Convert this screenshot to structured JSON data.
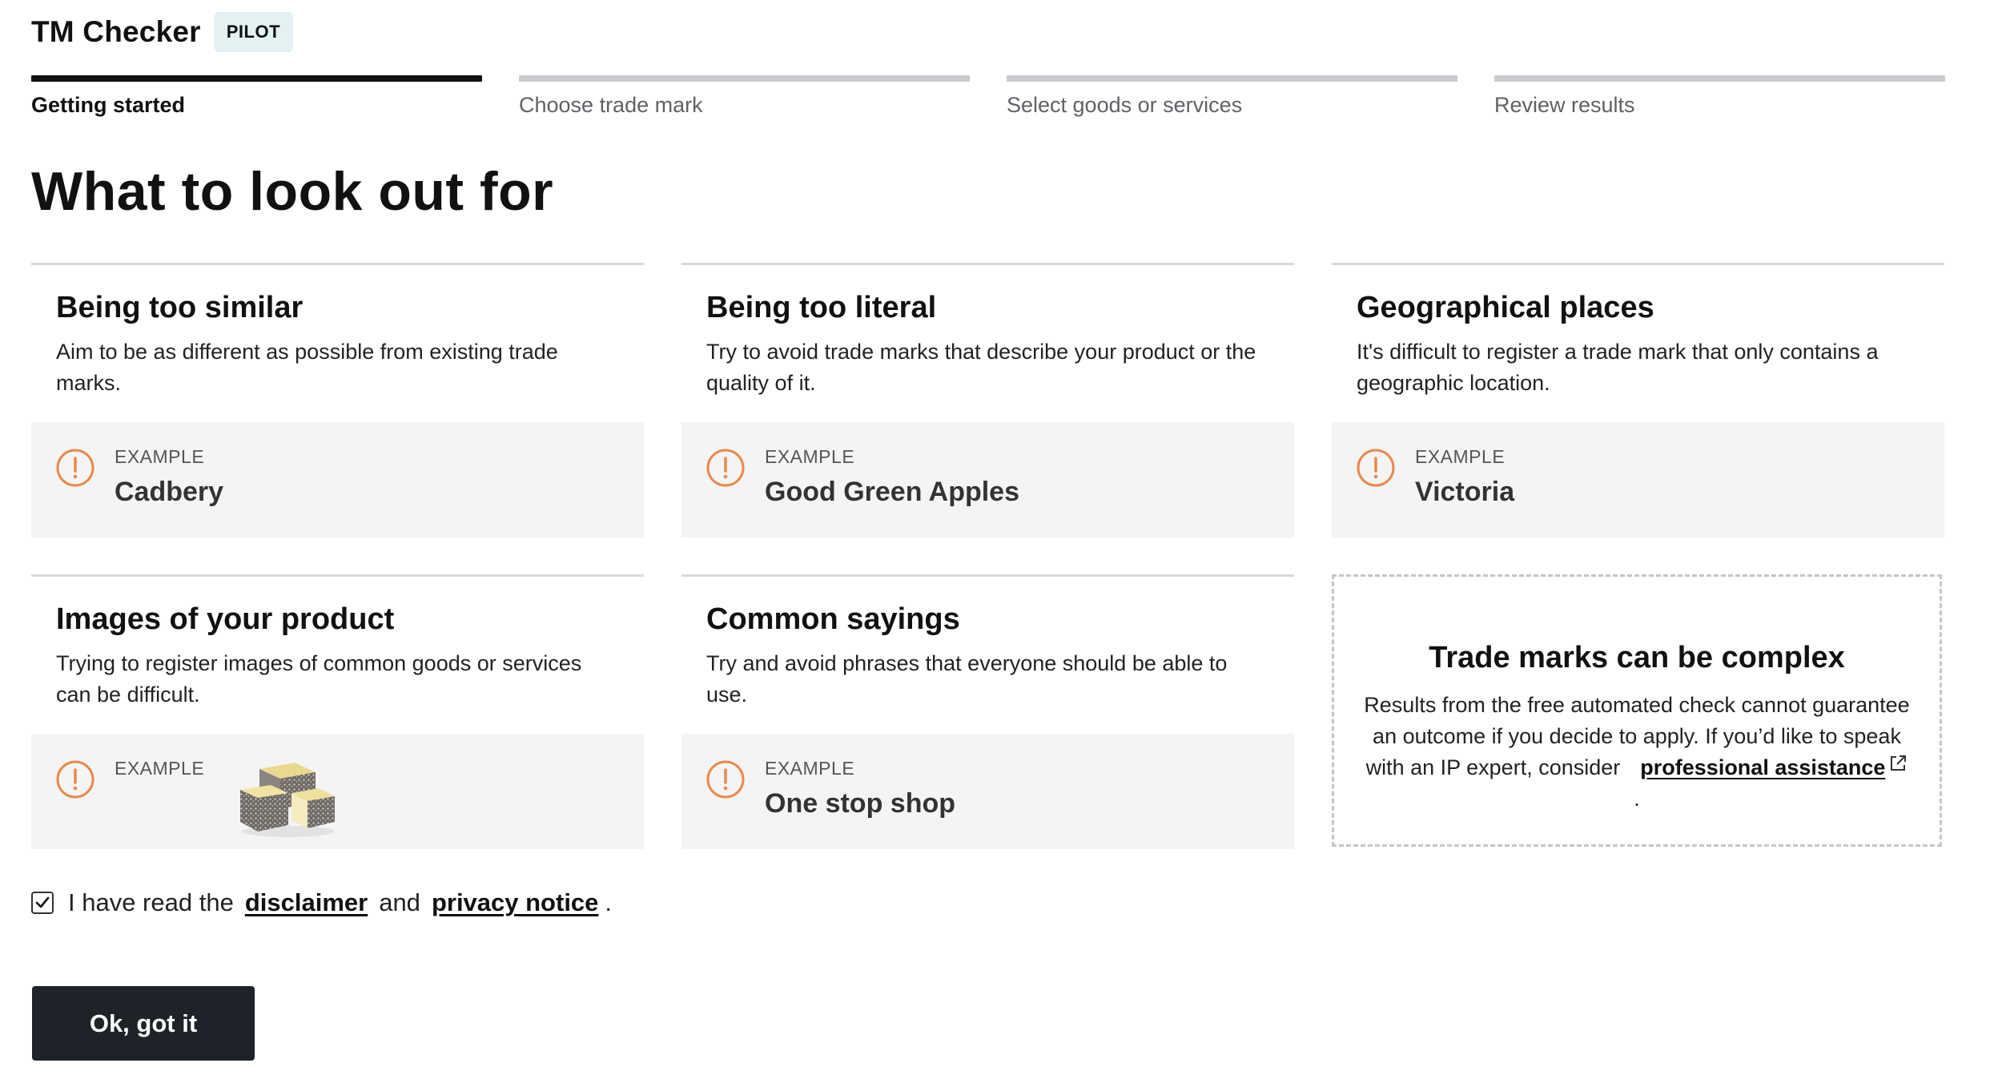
{
  "header": {
    "app_title": "TM Checker",
    "badge": "PILOT"
  },
  "steps": [
    {
      "label": "Getting started",
      "active": true
    },
    {
      "label": "Choose trade mark",
      "active": false
    },
    {
      "label": "Select goods or services",
      "active": false
    },
    {
      "label": "Review results",
      "active": false
    }
  ],
  "page_title": "What to look out for",
  "cards": [
    {
      "title": "Being too similar",
      "text": "Aim to be as different as possible from existing trade marks.",
      "example_label": "EXAMPLE",
      "example_value": "Cadbery"
    },
    {
      "title": "Being too literal",
      "text": "Try to avoid trade marks that describe your product or the quality of it.",
      "example_label": "EXAMPLE",
      "example_value": "Good Green Apples"
    },
    {
      "title": "Geographical places",
      "text": "It's difficult to register a trade mark that only contains a geographic location.",
      "example_label": "EXAMPLE",
      "example_value": "Victoria"
    },
    {
      "title": "Images of your product",
      "text": "Trying to register images of common goods or services can be difficult.",
      "example_label": "EXAMPLE",
      "example_image": "lamington-cake-image"
    },
    {
      "title": "Common sayings",
      "text": "Try and avoid phrases that everyone should be able to use.",
      "example_label": "EXAMPLE",
      "example_value": "One stop shop"
    }
  ],
  "info_box": {
    "title": "Trade marks can be complex",
    "text": "Results from the free automated check cannot guarantee an outcome if you decide to apply. If you’d like to speak with an IP expert, consider",
    "link": "professional assistance",
    "end": "."
  },
  "consent": {
    "checked": true,
    "text_before": "I have read the",
    "link1": "disclaimer",
    "text_middle": "and",
    "link2": "privacy notice",
    "text_end": "."
  },
  "button": {
    "label": "Ok, got it"
  },
  "colors": {
    "accent_warning": "#e8894a",
    "dark": "#1e2329",
    "step_active": "#111111",
    "step_inactive": "#c9c9ce",
    "example_bg": "#f4f4f5",
    "badge_bg": "#e3f1f3"
  },
  "icons": {
    "warning": "warning-circle-icon",
    "external_link": "external-link-icon",
    "check": "checkmark-icon"
  }
}
